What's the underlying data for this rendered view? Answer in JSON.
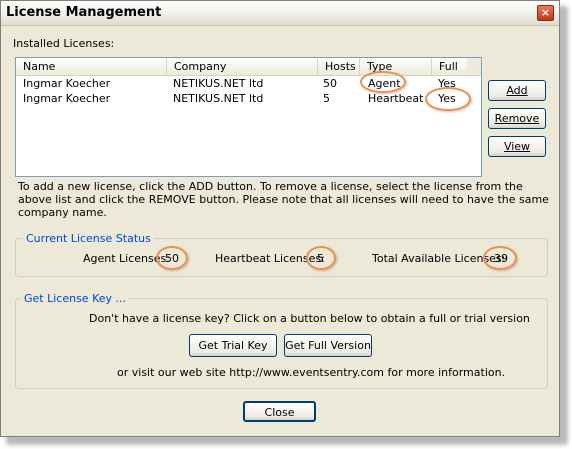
{
  "window": {
    "title": "License Management",
    "close_glyph": "×"
  },
  "installed_label": "Installed Licenses:",
  "list": {
    "columns": [
      "Name",
      "Company",
      "Hosts",
      "Type",
      "Full"
    ],
    "rows": [
      {
        "name": "Ingmar Koecher",
        "company": "NETIKUS.NET ltd",
        "hosts": "50",
        "type": "Agent",
        "full": "Yes"
      },
      {
        "name": "Ingmar Koecher",
        "company": "NETIKUS.NET ltd",
        "hosts": "5",
        "type": "Heartbeat",
        "full": "Yes"
      }
    ]
  },
  "buttons": {
    "add": "Add",
    "remove": "Remove",
    "view": "View"
  },
  "help_text": [
    "To add a new license, click the ADD button. To remove a license, select the license from the",
    "above list and click the REMOVE button. Please note that all licenses will need to have the same",
    "company name."
  ],
  "status": {
    "title": "Current License Status",
    "agent_label": "Agent Licenses:",
    "agent_value": "50",
    "heartbeat_label": "Heartbeat Licenses:",
    "heartbeat_value": "5",
    "total_label": "Total Available Licenses:",
    "total_value": "39"
  },
  "key": {
    "title": "Get License Key ...",
    "prompt": "Don't have a license key? Click on a button below to obtain a full or trial version",
    "trial_button": "Get Trial Key",
    "full_button": "Get Full Version",
    "visit": "or visit our web site http://www.eventsentry.com for more information."
  },
  "close_button": "Close",
  "colors": {
    "accent": "#0046d5",
    "highlight_circle": "#e8904f"
  }
}
